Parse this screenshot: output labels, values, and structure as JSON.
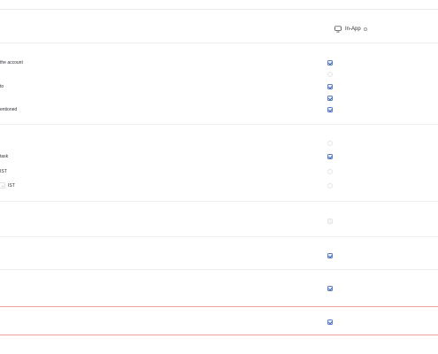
{
  "header": {
    "inapp_label": "In-App"
  },
  "rows": [
    {
      "label": "the account",
      "state": "checked"
    },
    {
      "label": "",
      "state": "unchecked"
    },
    {
      "label": "to",
      "state": "checked"
    },
    {
      "label": "",
      "state": "checked"
    },
    {
      "label": "entioned",
      "state": "checked"
    },
    {
      "label": "",
      "state": "unchecked"
    },
    {
      "label": "task",
      "state": "checked"
    },
    {
      "label": "IST",
      "state": "unchecked"
    },
    {
      "label": "IST",
      "state": "unchecked"
    },
    {
      "label": "",
      "state": "disabled"
    },
    {
      "label": "",
      "state": "checked"
    },
    {
      "label": "",
      "state": "checked"
    },
    {
      "label": "",
      "state": "checked"
    }
  ]
}
